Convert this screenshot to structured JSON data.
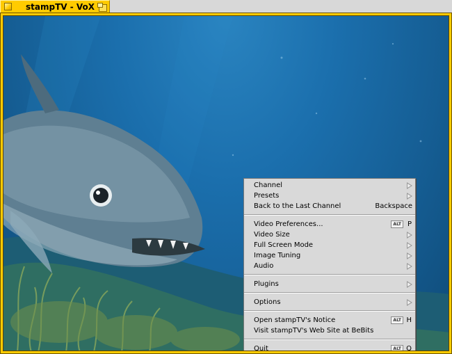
{
  "window": {
    "title": "stampTV - VoX"
  },
  "colors": {
    "title_tab": "#ffcb00",
    "menu_background": "#d9d9d9",
    "water": "#1b6fad"
  },
  "menu": {
    "groups": [
      [
        {
          "label": "Channel",
          "shortcut_type": "submenu"
        },
        {
          "label": "Presets",
          "shortcut_type": "submenu"
        },
        {
          "label": "Back to the Last Channel",
          "shortcut_type": "text",
          "shortcut": "Backspace"
        }
      ],
      [
        {
          "label": "Video Preferences...",
          "shortcut_type": "alt",
          "alt": "ALT",
          "key": "P"
        },
        {
          "label": "Video Size",
          "shortcut_type": "submenu"
        },
        {
          "label": "Full Screen Mode",
          "shortcut_type": "submenu"
        },
        {
          "label": "Image Tuning",
          "shortcut_type": "submenu"
        },
        {
          "label": "Audio",
          "shortcut_type": "submenu"
        }
      ],
      [
        {
          "label": "Plugins",
          "shortcut_type": "submenu"
        }
      ],
      [
        {
          "label": "Options",
          "shortcut_type": "submenu"
        }
      ],
      [
        {
          "label": "Open stampTV's Notice",
          "shortcut_type": "alt",
          "alt": "ALT",
          "key": "H"
        },
        {
          "label": "Visit stampTV's Web Site at BeBits",
          "shortcut_type": "none"
        }
      ],
      [
        {
          "label": "Quit",
          "shortcut_type": "alt",
          "alt": "ALT",
          "key": "Q"
        }
      ]
    ]
  }
}
